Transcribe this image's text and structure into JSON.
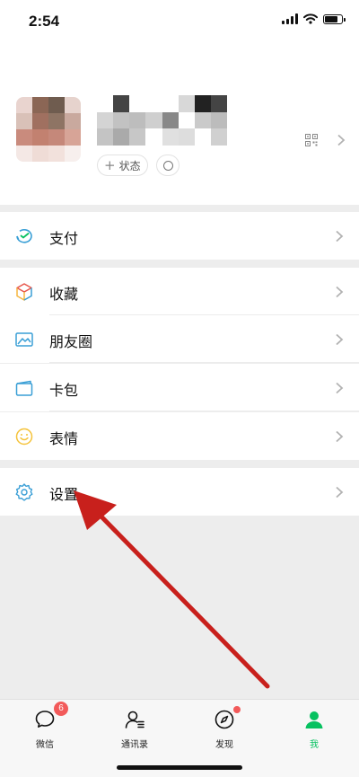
{
  "status_bar": {
    "time": "2:54",
    "battery_level": 0.85
  },
  "profile": {
    "status_label": "状态"
  },
  "menu": {
    "pay": "支付",
    "favorites": "收藏",
    "moments": "朋友圈",
    "cards": "卡包",
    "stickers": "表情",
    "settings": "设置"
  },
  "tabbar": {
    "chats": {
      "label": "微信",
      "badge": "6"
    },
    "contacts": {
      "label": "通讯录"
    },
    "discover": {
      "label": "发现"
    },
    "me": {
      "label": "我"
    }
  },
  "colors": {
    "accent_green": "#07c160",
    "badge_red": "#f25a5a",
    "annotation_arrow": "#c8201c"
  }
}
